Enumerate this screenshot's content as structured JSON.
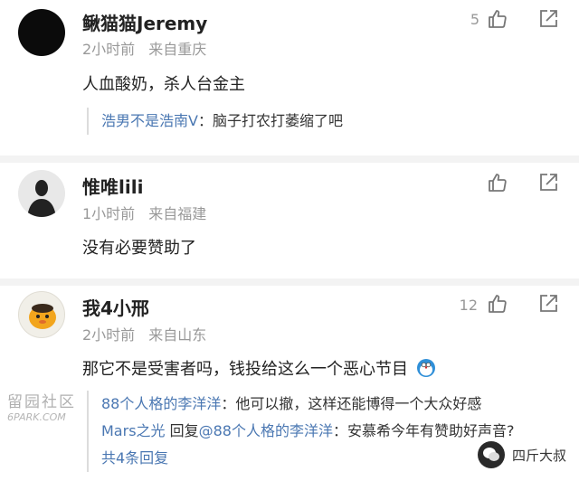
{
  "comments": [
    {
      "username": "鳅猫猫Jeremy",
      "time": "2小时前",
      "location": "来自重庆",
      "text": "人血酸奶，杀人台金主",
      "likes": "5",
      "reply": {
        "name": "浩男不是浩南V",
        "sep": "：",
        "text": "脑子打农打萎缩了吧"
      }
    },
    {
      "username": "惟唯lili",
      "time": "1小时前",
      "location": "来自福建",
      "text": "没有必要赞助了",
      "likes": ""
    },
    {
      "username": "我4小邢",
      "time": "2小时前",
      "location": "来自山东",
      "text": "那它不是受害者吗，钱投给这么一个恶心节目",
      "likes": "12",
      "replies": [
        {
          "name": "88个人格的李洋洋",
          "sep": "：",
          "text": "他可以撤，这样还能博得一个大众好感"
        },
        {
          "name": "Mars之光",
          "mid": " 回复",
          "target": "@88个人格的李洋洋",
          "sep": "：",
          "text": "安慕希今年有赞助好声音?"
        }
      ],
      "more": "共4条回复"
    }
  ],
  "watermark_left": {
    "cn": "留园社区",
    "en": "6PARK.COM"
  },
  "watermark_right": {
    "text": "四斤大叔"
  },
  "colors": {
    "link": "#4a77b2",
    "meta": "#999999",
    "divider": "#f3f3f3"
  },
  "icons": [
    "thumbs-up-icon",
    "share-icon"
  ]
}
